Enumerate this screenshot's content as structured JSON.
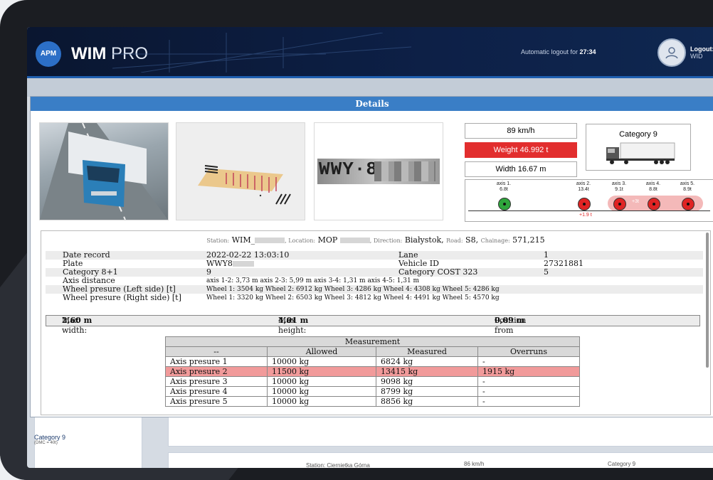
{
  "app": {
    "brand_short": "APM",
    "brand_bold": "WIM",
    "brand_light": " PRO"
  },
  "header": {
    "autologout_prefix": "Automatic logout for ",
    "autologout_time": "27:34",
    "logout_label": "Logout:",
    "user": "WID"
  },
  "modal": {
    "title": "Details"
  },
  "summary": {
    "speed": "89 km/h",
    "weight": "Weight 46.992 t",
    "width": "Width 16.67 m",
    "category": "Category 9"
  },
  "axles": [
    {
      "label": "axis 1.",
      "value": "6.8t",
      "status": "ok"
    },
    {
      "label": "axis 2.",
      "value": "13.4t",
      "status": "over"
    },
    {
      "label": "axis 3.",
      "value": "9.1t",
      "status": "over"
    },
    {
      "label": "axis 4.",
      "value": "8.8t",
      "status": "over"
    },
    {
      "label": "axis 5.",
      "value": "8.9t",
      "status": "over"
    }
  ],
  "axle_notes": {
    "group_overload": "+3t",
    "axis2_overload": "+1.9 t"
  },
  "plate_visible": "WWY·8",
  "station_line": {
    "station_label": "Station:",
    "station_value": "WIM_",
    "location_label": ", Location:",
    "location_value": "MOP",
    "direction_label": ", Direction:",
    "direction_value": "Białystok,",
    "road_label": "Road:",
    "road_value": "S8,",
    "chainage_label": "Chainage:",
    "chainage_value": "571,215"
  },
  "details": {
    "date_label": "Date record",
    "date_value": "2022-02-22 13:03:10",
    "lane_label": "Lane",
    "lane_value": "1",
    "plate_label": "Plate",
    "plate_value": "WWY8",
    "vehicle_id_label": "Vehicle ID",
    "vehicle_id_value": "27321881",
    "cat81_label": "Category 8+1",
    "cat81_value": "9",
    "cost_label": "Category COST 323",
    "cost_value": "5",
    "axis_distance_label": "Axis distance",
    "axis_distance_value": "axis 1-2: 3,73 m   axis 2-3: 5,99 m   axis 3-4: 1,31 m   axis 4-5: 1,31 m",
    "wheel_left_label": "Wheel presure (Left side) [t]",
    "wheel_left_value": "Wheel 1: 3504 kg Wheel 2: 6912 kg Wheel 3: 4286 kg Wheel 4: 4308 kg Wheel 5: 4286 kg",
    "wheel_right_label": "Wheel presure (Right side) [t]",
    "wheel_right_value": "Wheel 1: 3320 kg Wheel 2: 6503 kg Wheel 3: 4812 kg Wheel 4: 4491 kg Wheel 5: 4570 kg"
  },
  "dimensions": {
    "max_width_label": "Max width:",
    "max_width_value": "2,60 m",
    "max_height_label": "Max height:",
    "max_height_value": "4,01 m",
    "position_label": "Position from lane center:",
    "position_value": "0,09 m"
  },
  "measurement": {
    "title": "Measurement",
    "headers": [
      "--",
      "Allowed",
      "Measured",
      "Overruns"
    ],
    "rows": [
      {
        "name": "Axis presure 1",
        "allowed": "10000 kg",
        "measured": "6824 kg",
        "overrun": "-"
      },
      {
        "name": "Axis presure 2",
        "allowed": "11500 kg",
        "measured": "13415 kg",
        "overrun": "1915 kg"
      },
      {
        "name": "Axis presure 3",
        "allowed": "10000 kg",
        "measured": "9098 kg",
        "overrun": "-"
      },
      {
        "name": "Axis presure 4",
        "allowed": "10000 kg",
        "measured": "8799 kg",
        "overrun": "-"
      },
      {
        "name": "Axis presure 5",
        "allowed": "10000 kg",
        "measured": "8856 kg",
        "overrun": "-"
      }
    ]
  },
  "background": {
    "category_item": "Category 9",
    "category_sub": "(DMC = 40t)",
    "station_text": "Station: Ciernietka Górna",
    "speed_text": "86 km/h",
    "category_text": "Category 9"
  },
  "colors": {
    "accent": "#3a7ec6",
    "alert": "#e22e2e",
    "ok": "#2fa53c"
  }
}
